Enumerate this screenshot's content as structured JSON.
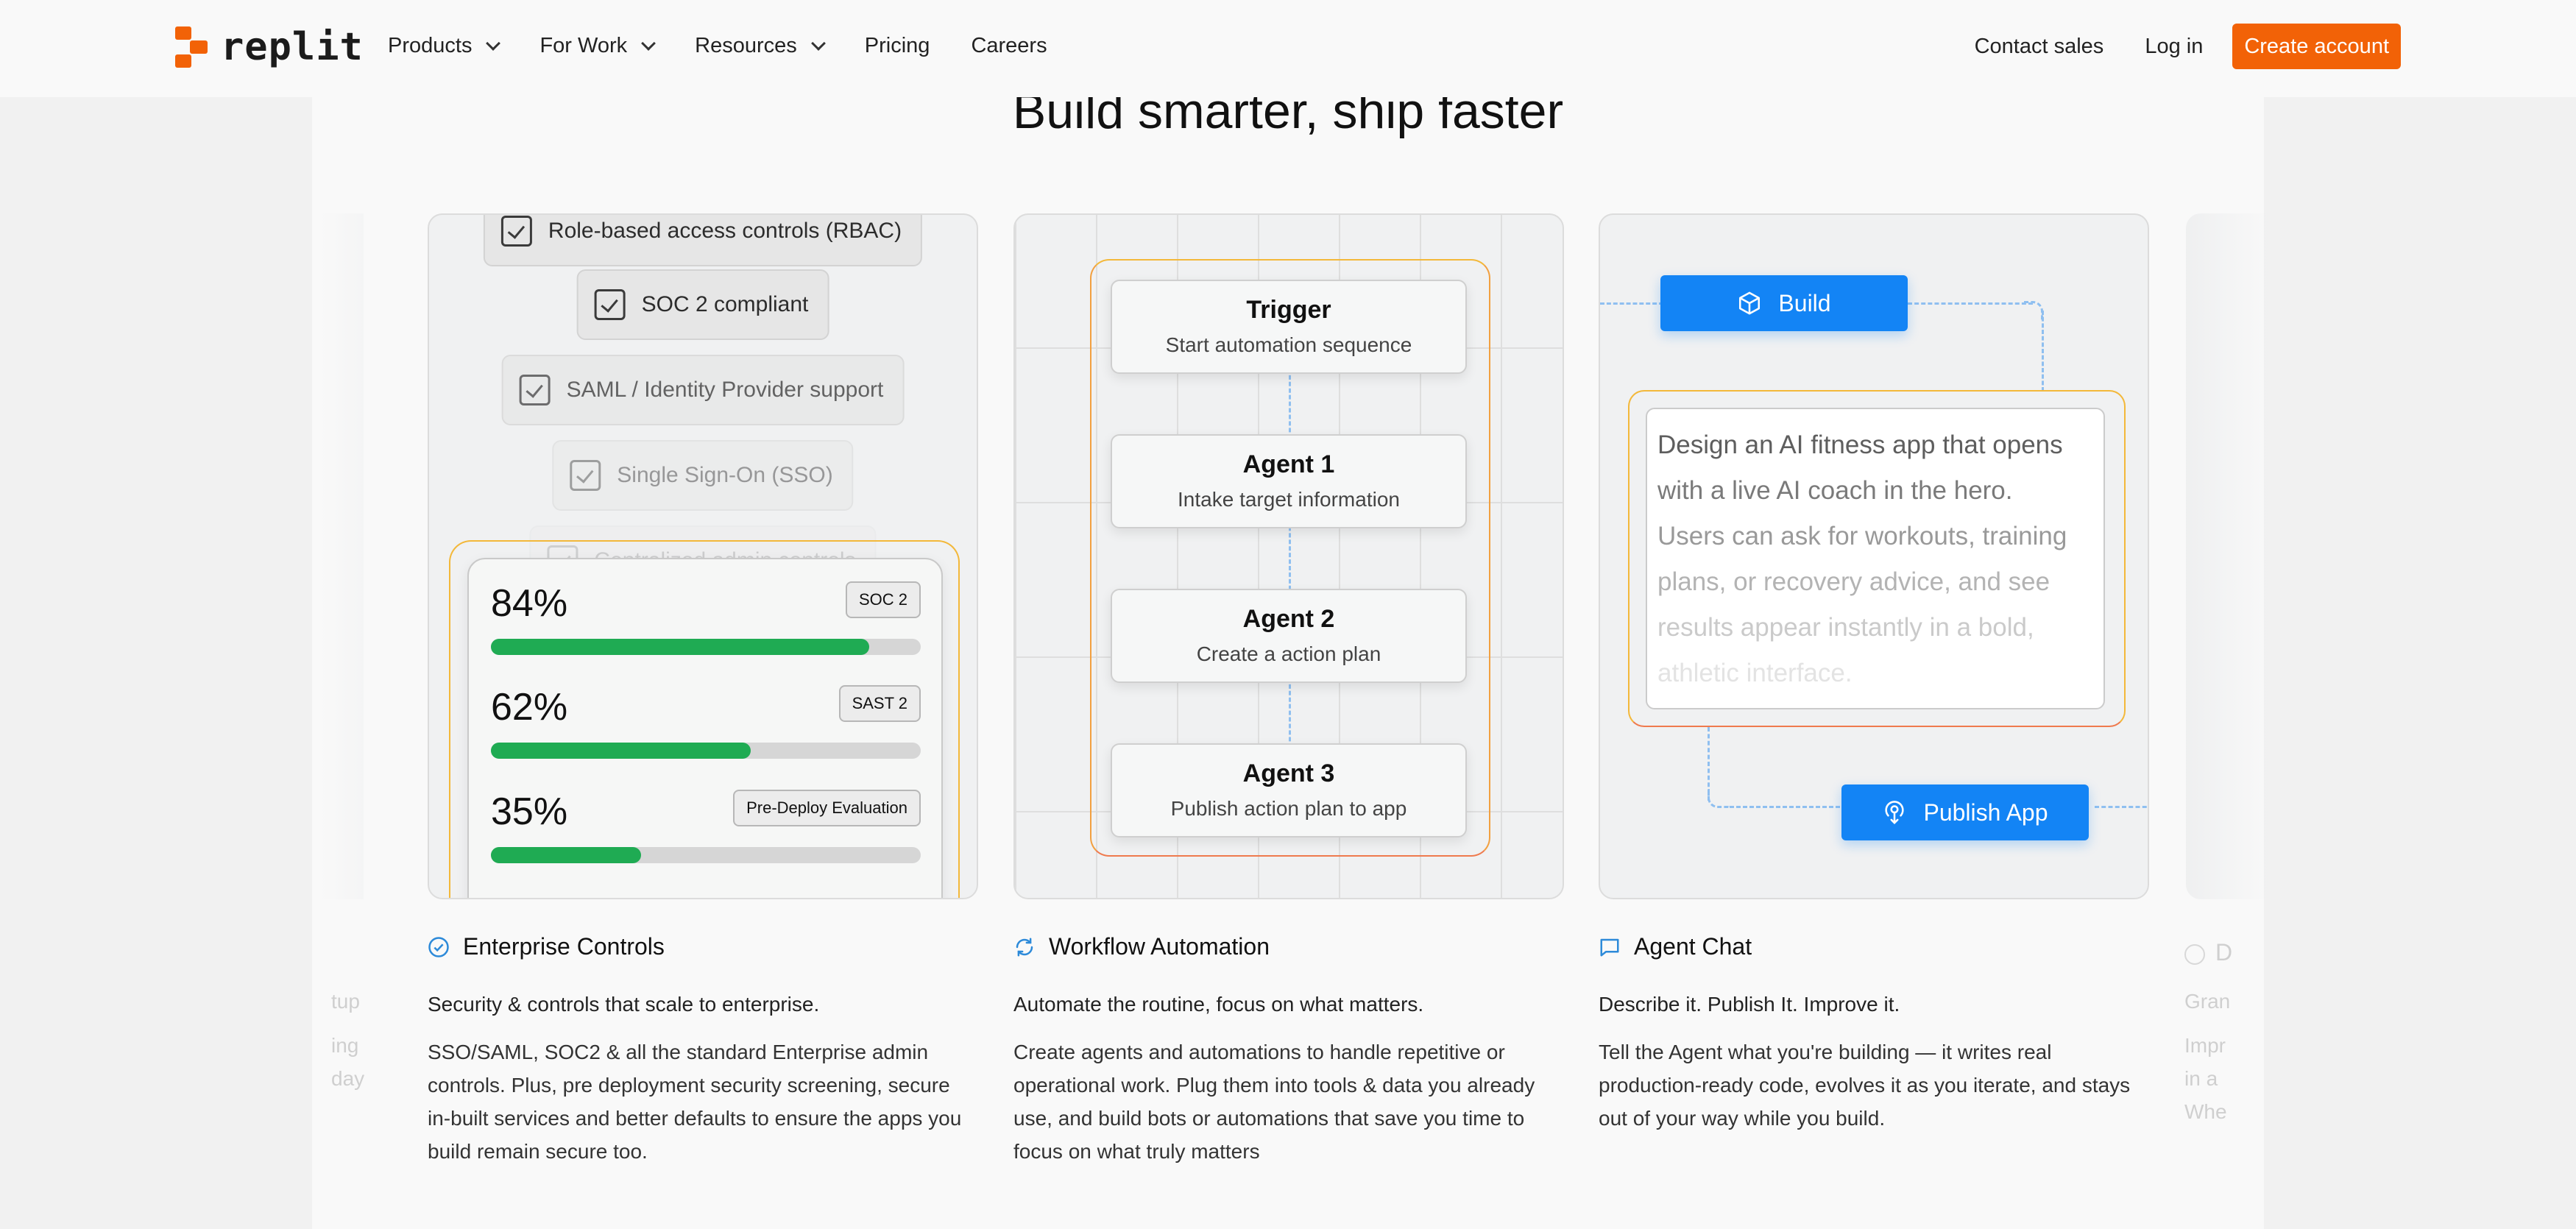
{
  "nav": {
    "logo_text": "replit",
    "items": [
      {
        "label": "Products",
        "dropdown": true
      },
      {
        "label": "For Work",
        "dropdown": true
      },
      {
        "label": "Resources",
        "dropdown": true
      },
      {
        "label": "Pricing",
        "dropdown": false
      },
      {
        "label": "Careers",
        "dropdown": false
      }
    ],
    "contact_sales": "Contact sales",
    "log_in": "Log in",
    "create_account": "Create account"
  },
  "section": {
    "title": "Build smarter, ship faster"
  },
  "enterprise": {
    "features": [
      "Role-based access controls (RBAC)",
      "SOC 2 compliant",
      "SAML / Identity Provider support",
      "Single Sign-On (SSO)",
      "Centralized admin controls"
    ],
    "scores": [
      {
        "value": "84%",
        "tag": "SOC 2",
        "fraction": 0.88
      },
      {
        "value": "62%",
        "tag": "SAST 2",
        "fraction": 0.605
      },
      {
        "value": "35%",
        "tag": "Pre-Deploy Evaluation",
        "fraction": 0.35
      }
    ],
    "title": "Enterprise Controls",
    "lead": "Security & controls that scale to enterprise.",
    "body": "SSO/SAML, SOC2 & all the standard Enterprise admin controls. Plus, pre deployment security screening, secure in-built services and better defaults to ensure the apps you build remain secure too."
  },
  "workflow": {
    "nodes": [
      {
        "title": "Trigger",
        "subtitle": "Start automation sequence"
      },
      {
        "title": "Agent 1",
        "subtitle": "Intake target information"
      },
      {
        "title": "Agent 2",
        "subtitle": "Create a action plan"
      },
      {
        "title": "Agent 3",
        "subtitle": "Publish action plan to app"
      }
    ],
    "title": "Workflow Automation",
    "lead": "Automate the routine, focus on what matters.",
    "body": "Create agents and automations to handle repetitive or operational work. Plug them into tools & data you already use, and build bots or automations that save you time to focus on what truly matters"
  },
  "agent_chat": {
    "build_label": "Build",
    "publish_label": "Publish App",
    "prompt_lines": [
      "Design an AI fitness app that opens",
      "with a live AI coach in the hero.",
      "Users can ask for workouts, training",
      "plans, or recovery advice, and see",
      "results appear instantly in a bold,",
      "athletic interface."
    ],
    "title": "Agent Chat",
    "lead": "Describe it. Publish It. Improve it.",
    "body": "Tell the Agent what you're building — it writes real production-ready code, evolves it as you iterate, and stays out of your way while you build."
  },
  "ghost": {
    "left_lines": [
      "tup",
      "ing",
      "day"
    ],
    "right_title": "D",
    "right_lead": "Gran",
    "right_lines": [
      "Impr",
      "in a",
      "Whe"
    ]
  },
  "colors": {
    "brand": "#f26207",
    "accent_blue": "#1384f5",
    "progress_green": "#1fab53"
  }
}
